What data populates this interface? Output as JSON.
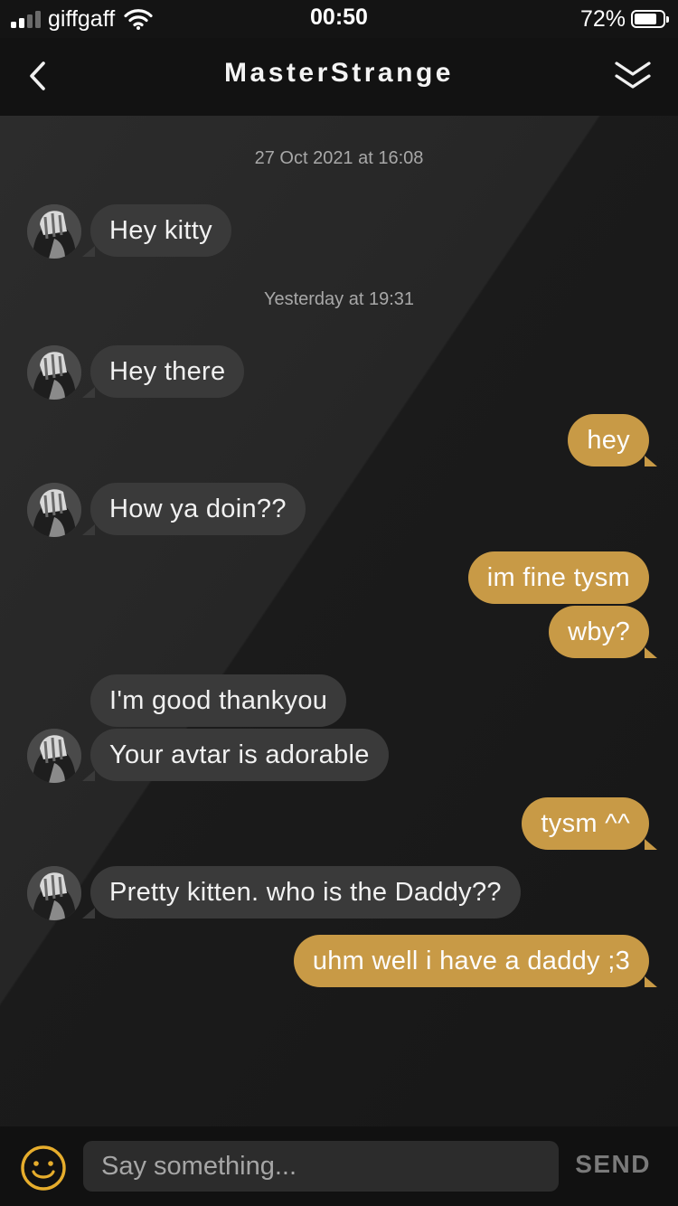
{
  "status_bar": {
    "carrier": "giffgaff",
    "time": "00:50",
    "battery_percent": "72%",
    "battery_level": 0.72,
    "signal_bars": 4,
    "signal_bars_filled": 2,
    "icons": [
      "signal-icon",
      "wifi-icon",
      "battery-icon"
    ]
  },
  "header": {
    "title": "MasterStrange",
    "icons": [
      "back-chevron-icon",
      "double-chevron-down-icon"
    ]
  },
  "conversation": {
    "timestamps": [
      "27 Oct 2021 at 16:08",
      "Yesterday at 19:31"
    ],
    "messages": [
      {
        "from": "them",
        "text": "Hey kitty"
      },
      {
        "from": "them",
        "text": "Hey there"
      },
      {
        "from": "me",
        "text": "hey"
      },
      {
        "from": "them",
        "text": "How ya doin??"
      },
      {
        "from": "me",
        "text": "im fine tysm"
      },
      {
        "from": "me",
        "text": "wby?"
      },
      {
        "from": "them",
        "text": "I'm good thankyou"
      },
      {
        "from": "them",
        "text": "Your avtar is adorable"
      },
      {
        "from": "me",
        "text": "tysm ^^"
      },
      {
        "from": "them",
        "text": "Pretty kitten. who is the Daddy??"
      },
      {
        "from": "me",
        "text": "uhm well i have a daddy ;3"
      }
    ]
  },
  "composer": {
    "placeholder": "Say something...",
    "value": "",
    "send_label": "SEND",
    "icons": [
      "smiley-icon"
    ]
  },
  "colors": {
    "incoming_bubble": "#3a3a3a",
    "outgoing_bubble": "#c89a46",
    "accent_emoji": "#e6ad2c",
    "background": "#141414"
  }
}
